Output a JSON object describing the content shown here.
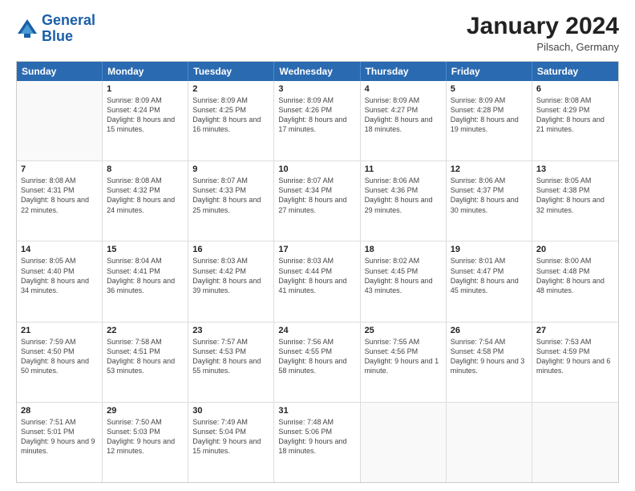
{
  "logo": {
    "line1": "General",
    "line2": "Blue"
  },
  "title": "January 2024",
  "location": "Pilsach, Germany",
  "header_days": [
    "Sunday",
    "Monday",
    "Tuesday",
    "Wednesday",
    "Thursday",
    "Friday",
    "Saturday"
  ],
  "weeks": [
    [
      {
        "day": "",
        "sunrise": "",
        "sunset": "",
        "daylight": ""
      },
      {
        "day": "1",
        "sunrise": "Sunrise: 8:09 AM",
        "sunset": "Sunset: 4:24 PM",
        "daylight": "Daylight: 8 hours and 15 minutes."
      },
      {
        "day": "2",
        "sunrise": "Sunrise: 8:09 AM",
        "sunset": "Sunset: 4:25 PM",
        "daylight": "Daylight: 8 hours and 16 minutes."
      },
      {
        "day": "3",
        "sunrise": "Sunrise: 8:09 AM",
        "sunset": "Sunset: 4:26 PM",
        "daylight": "Daylight: 8 hours and 17 minutes."
      },
      {
        "day": "4",
        "sunrise": "Sunrise: 8:09 AM",
        "sunset": "Sunset: 4:27 PM",
        "daylight": "Daylight: 8 hours and 18 minutes."
      },
      {
        "day": "5",
        "sunrise": "Sunrise: 8:09 AM",
        "sunset": "Sunset: 4:28 PM",
        "daylight": "Daylight: 8 hours and 19 minutes."
      },
      {
        "day": "6",
        "sunrise": "Sunrise: 8:08 AM",
        "sunset": "Sunset: 4:29 PM",
        "daylight": "Daylight: 8 hours and 21 minutes."
      }
    ],
    [
      {
        "day": "7",
        "sunrise": "Sunrise: 8:08 AM",
        "sunset": "Sunset: 4:31 PM",
        "daylight": "Daylight: 8 hours and 22 minutes."
      },
      {
        "day": "8",
        "sunrise": "Sunrise: 8:08 AM",
        "sunset": "Sunset: 4:32 PM",
        "daylight": "Daylight: 8 hours and 24 minutes."
      },
      {
        "day": "9",
        "sunrise": "Sunrise: 8:07 AM",
        "sunset": "Sunset: 4:33 PM",
        "daylight": "Daylight: 8 hours and 25 minutes."
      },
      {
        "day": "10",
        "sunrise": "Sunrise: 8:07 AM",
        "sunset": "Sunset: 4:34 PM",
        "daylight": "Daylight: 8 hours and 27 minutes."
      },
      {
        "day": "11",
        "sunrise": "Sunrise: 8:06 AM",
        "sunset": "Sunset: 4:36 PM",
        "daylight": "Daylight: 8 hours and 29 minutes."
      },
      {
        "day": "12",
        "sunrise": "Sunrise: 8:06 AM",
        "sunset": "Sunset: 4:37 PM",
        "daylight": "Daylight: 8 hours and 30 minutes."
      },
      {
        "day": "13",
        "sunrise": "Sunrise: 8:05 AM",
        "sunset": "Sunset: 4:38 PM",
        "daylight": "Daylight: 8 hours and 32 minutes."
      }
    ],
    [
      {
        "day": "14",
        "sunrise": "Sunrise: 8:05 AM",
        "sunset": "Sunset: 4:40 PM",
        "daylight": "Daylight: 8 hours and 34 minutes."
      },
      {
        "day": "15",
        "sunrise": "Sunrise: 8:04 AM",
        "sunset": "Sunset: 4:41 PM",
        "daylight": "Daylight: 8 hours and 36 minutes."
      },
      {
        "day": "16",
        "sunrise": "Sunrise: 8:03 AM",
        "sunset": "Sunset: 4:42 PM",
        "daylight": "Daylight: 8 hours and 39 minutes."
      },
      {
        "day": "17",
        "sunrise": "Sunrise: 8:03 AM",
        "sunset": "Sunset: 4:44 PM",
        "daylight": "Daylight: 8 hours and 41 minutes."
      },
      {
        "day": "18",
        "sunrise": "Sunrise: 8:02 AM",
        "sunset": "Sunset: 4:45 PM",
        "daylight": "Daylight: 8 hours and 43 minutes."
      },
      {
        "day": "19",
        "sunrise": "Sunrise: 8:01 AM",
        "sunset": "Sunset: 4:47 PM",
        "daylight": "Daylight: 8 hours and 45 minutes."
      },
      {
        "day": "20",
        "sunrise": "Sunrise: 8:00 AM",
        "sunset": "Sunset: 4:48 PM",
        "daylight": "Daylight: 8 hours and 48 minutes."
      }
    ],
    [
      {
        "day": "21",
        "sunrise": "Sunrise: 7:59 AM",
        "sunset": "Sunset: 4:50 PM",
        "daylight": "Daylight: 8 hours and 50 minutes."
      },
      {
        "day": "22",
        "sunrise": "Sunrise: 7:58 AM",
        "sunset": "Sunset: 4:51 PM",
        "daylight": "Daylight: 8 hours and 53 minutes."
      },
      {
        "day": "23",
        "sunrise": "Sunrise: 7:57 AM",
        "sunset": "Sunset: 4:53 PM",
        "daylight": "Daylight: 8 hours and 55 minutes."
      },
      {
        "day": "24",
        "sunrise": "Sunrise: 7:56 AM",
        "sunset": "Sunset: 4:55 PM",
        "daylight": "Daylight: 8 hours and 58 minutes."
      },
      {
        "day": "25",
        "sunrise": "Sunrise: 7:55 AM",
        "sunset": "Sunset: 4:56 PM",
        "daylight": "Daylight: 9 hours and 1 minute."
      },
      {
        "day": "26",
        "sunrise": "Sunrise: 7:54 AM",
        "sunset": "Sunset: 4:58 PM",
        "daylight": "Daylight: 9 hours and 3 minutes."
      },
      {
        "day": "27",
        "sunrise": "Sunrise: 7:53 AM",
        "sunset": "Sunset: 4:59 PM",
        "daylight": "Daylight: 9 hours and 6 minutes."
      }
    ],
    [
      {
        "day": "28",
        "sunrise": "Sunrise: 7:51 AM",
        "sunset": "Sunset: 5:01 PM",
        "daylight": "Daylight: 9 hours and 9 minutes."
      },
      {
        "day": "29",
        "sunrise": "Sunrise: 7:50 AM",
        "sunset": "Sunset: 5:03 PM",
        "daylight": "Daylight: 9 hours and 12 minutes."
      },
      {
        "day": "30",
        "sunrise": "Sunrise: 7:49 AM",
        "sunset": "Sunset: 5:04 PM",
        "daylight": "Daylight: 9 hours and 15 minutes."
      },
      {
        "day": "31",
        "sunrise": "Sunrise: 7:48 AM",
        "sunset": "Sunset: 5:06 PM",
        "daylight": "Daylight: 9 hours and 18 minutes."
      },
      {
        "day": "",
        "sunrise": "",
        "sunset": "",
        "daylight": ""
      },
      {
        "day": "",
        "sunrise": "",
        "sunset": "",
        "daylight": ""
      },
      {
        "day": "",
        "sunrise": "",
        "sunset": "",
        "daylight": ""
      }
    ]
  ]
}
